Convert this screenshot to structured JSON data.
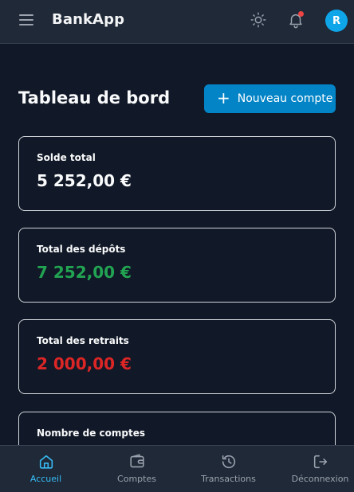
{
  "header": {
    "app_title": "BankApp",
    "avatar_initial": "R",
    "icons": [
      "menu-icon",
      "sun-icon",
      "bell-icon"
    ],
    "notification_dot_color": "#ef4444"
  },
  "main": {
    "title": "Tableau de bord",
    "new_account_label": "Nouveau compte",
    "cards": [
      {
        "label": "Solde total",
        "value": "5 252,00 €",
        "color": "#f9fafb"
      },
      {
        "label": "Total des dépôts",
        "value": "7 252,00 €",
        "color": "#22a352"
      },
      {
        "label": "Total des retraits",
        "value": "2 000,00 €",
        "color": "#dc2626"
      },
      {
        "label": "Nombre de comptes",
        "value": "",
        "color": "#f9fafb"
      }
    ]
  },
  "bottom_nav": {
    "items": [
      {
        "label": "Accueil",
        "icon": "home-icon",
        "active": true
      },
      {
        "label": "Comptes",
        "icon": "wallet-icon",
        "active": false
      },
      {
        "label": "Transactions",
        "icon": "history-icon",
        "active": false
      },
      {
        "label": "Déconnexion",
        "icon": "logout-icon",
        "active": false
      }
    ]
  },
  "colors": {
    "background": "#111827",
    "surface": "#1f2937",
    "accent": "#0284c7",
    "active_nav": "#38bdf8"
  }
}
